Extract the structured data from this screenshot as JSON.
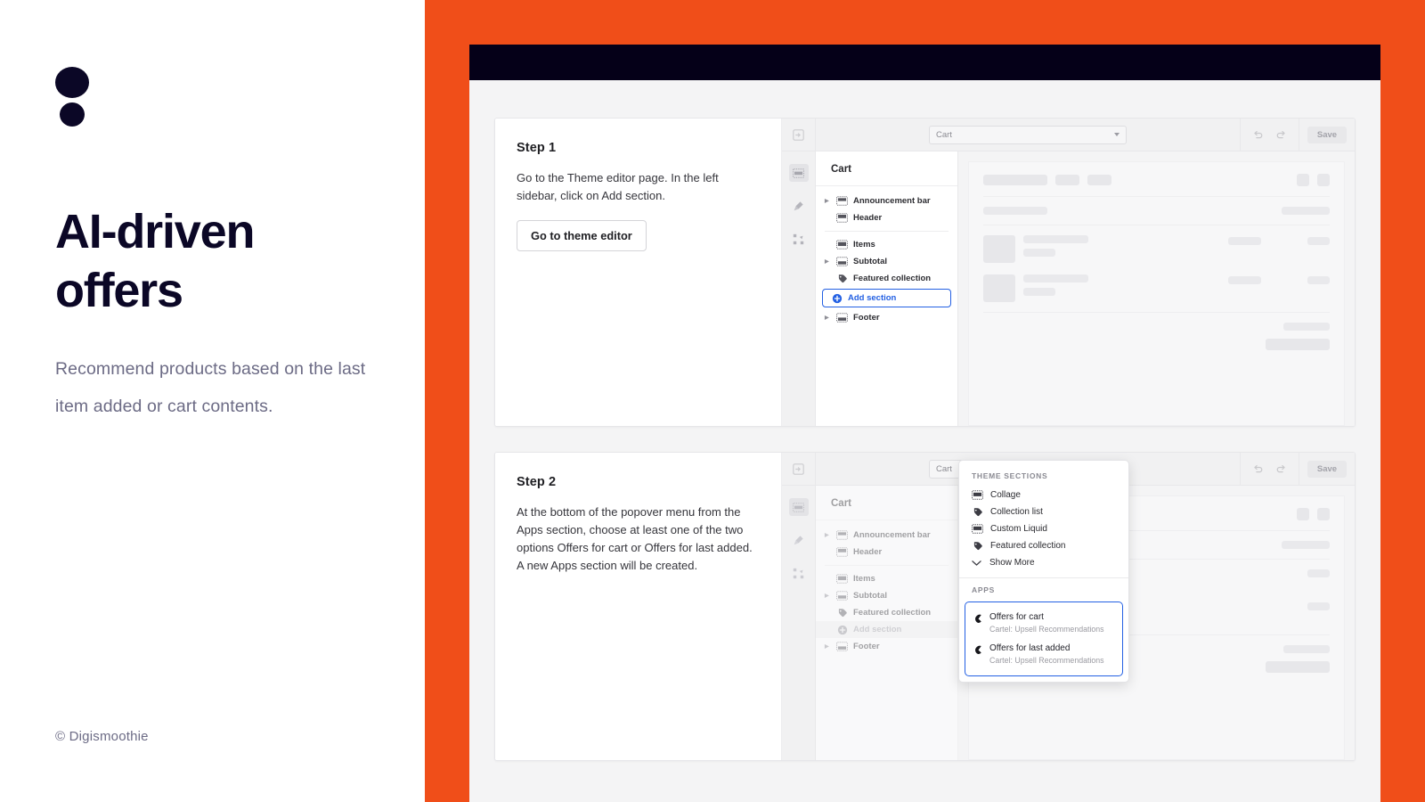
{
  "brand": {
    "logo_icon": "two-dots-logo",
    "headline": "AI-driven offers",
    "headline_line1": "AI-driven",
    "headline_line2": "offers",
    "subline": "Recommend products based on the last item added or cart contents.",
    "copyright": "© Digismoothie",
    "accent_orange": "#F04E19",
    "ink": "#0B0726",
    "muted": "#6C6B85",
    "focus_blue": "#2360E3"
  },
  "steps": [
    {
      "title": "Step 1",
      "description": "Go to the Theme editor page. In the left sidebar, click on Add section.",
      "button_label": "Go to theme editor"
    },
    {
      "title": "Step 2",
      "description": "At the bottom of the popover menu from the Apps section, choose at least one of the two options Offers for cart or Offers for last added. A new Apps section will be created.",
      "button_label": ""
    }
  ],
  "editor": {
    "toolbar": {
      "exit_icon": "exit-icon",
      "page_selector_value": "Cart",
      "caret_icon": "chevron-down-icon",
      "undo_icon": "undo-icon",
      "redo_icon": "redo-icon",
      "save_label": "Save"
    },
    "rail_icons": [
      "sections-icon",
      "brush-icon",
      "apps-icon"
    ],
    "sections_pane_title": "Cart",
    "sections": [
      {
        "label": "Announcement bar",
        "icon": "section-bar-icon",
        "expandable": true
      },
      {
        "label": "Header",
        "icon": "section-header-icon",
        "expandable": false
      },
      {
        "label": "Items",
        "icon": "section-items-icon",
        "expandable": false
      },
      {
        "label": "Subtotal",
        "icon": "section-subtotal-icon",
        "expandable": true
      },
      {
        "label": "Featured collection",
        "icon": "tag-icon",
        "expandable": false
      },
      {
        "label": "Add section",
        "icon": "plus-circle-icon",
        "expandable": false
      },
      {
        "label": "Footer",
        "icon": "section-footer-icon",
        "expandable": true
      }
    ]
  },
  "popover": {
    "theme_sections_label": "THEME SECTIONS",
    "theme_sections": [
      {
        "label": "Collage",
        "icon": "section-bar-icon"
      },
      {
        "label": "Collection list",
        "icon": "tag-icon"
      },
      {
        "label": "Custom Liquid",
        "icon": "section-bar-icon"
      },
      {
        "label": "Featured collection",
        "icon": "tag-icon"
      }
    ],
    "show_more_label": "Show More",
    "show_more_icon": "chevron-down-icon",
    "apps_label": "APPS",
    "apps": [
      {
        "name": "Offers for cart",
        "subtitle": "Cartel: Upsell Recommendations",
        "icon": "cartel-app-icon"
      },
      {
        "name": "Offers for last added",
        "subtitle": "Cartel: Upsell Recommendations",
        "icon": "cartel-app-icon"
      }
    ]
  }
}
